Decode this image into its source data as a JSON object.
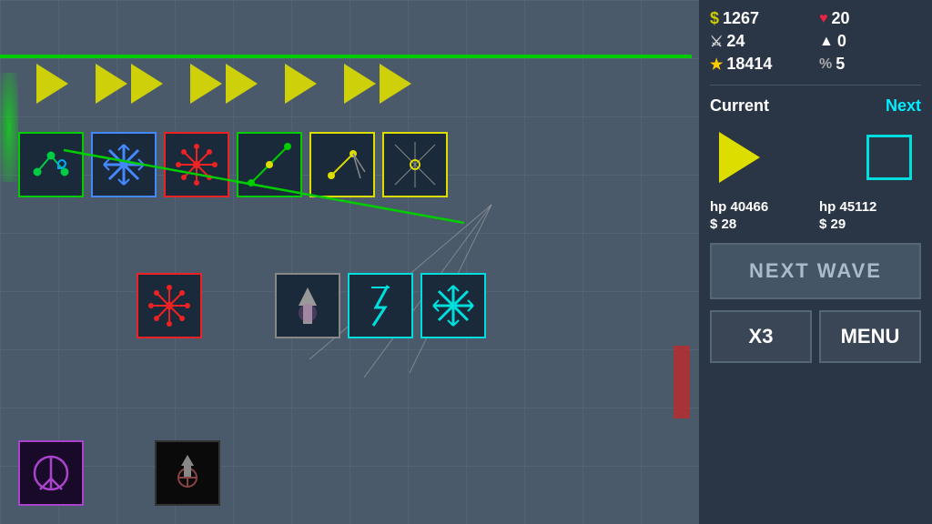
{
  "stats": {
    "money": "1267",
    "hearts": "20",
    "sword": "24",
    "arrow": "0",
    "star": "18414",
    "percent": "5"
  },
  "labels": {
    "current": "Current",
    "next": "Next",
    "current_hp": "hp 40466",
    "current_cost": "$ 28",
    "next_hp": "hp 45112",
    "next_cost": "$ 29",
    "next_wave": "NEXT WAVE",
    "x3": "X3",
    "menu": "MENU"
  }
}
